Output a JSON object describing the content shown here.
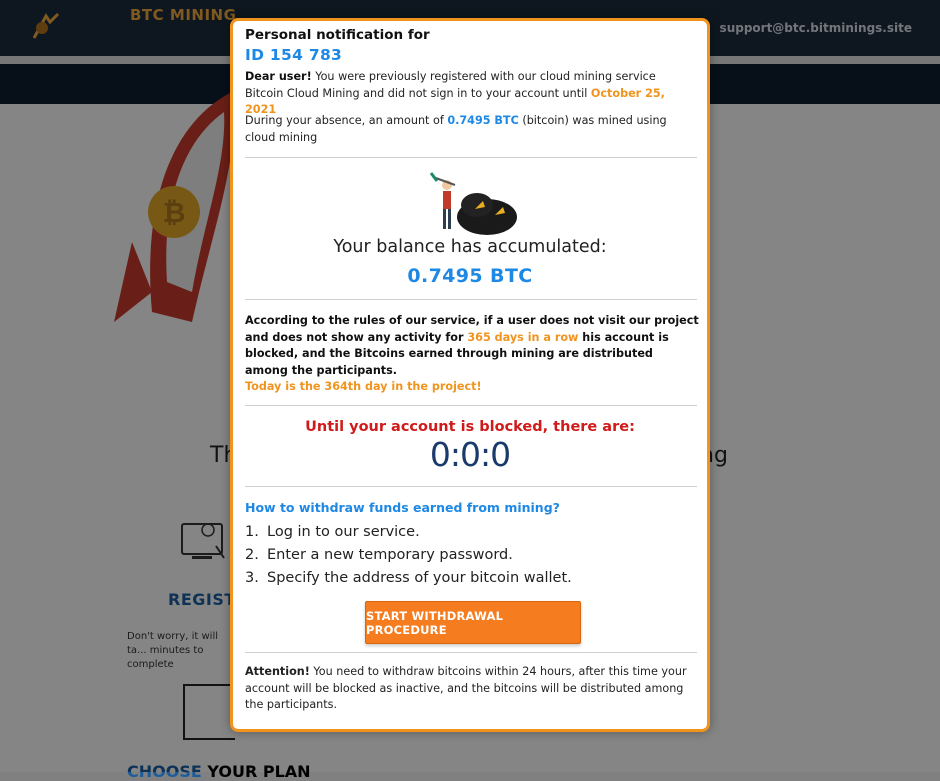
{
  "background": {
    "brand": "BTC MINING",
    "brand_sub": "",
    "support_email": "support@btc.bitminings.site",
    "section_title_left": "Th",
    "section_title_right": "ng",
    "register": "REGIST",
    "register_text": "Don't worry, it will ta... minutes to complete",
    "plan_accent": "CHOOSE",
    "plan_rest": " YOUR PLAN"
  },
  "modal": {
    "heading": "Personal notification for",
    "user_id": "ID 154 783",
    "greeting": "Dear user!",
    "intro": " You were previously registered with our cloud mining service Bitcoin Cloud Mining and did not sign in to your account until ",
    "last_date": "October 25, 2021",
    "absence_pre": "During your absence, an amount of ",
    "absence_amount": "0.7495 BTC",
    "absence_post": " (bitcoin) was mined using cloud mining",
    "balance_title": "Your balance has accumulated:",
    "balance_value": "0.7495 BTC",
    "rules_pre": "According to the rules of our service, if a user does not visit our project and does not show any activity for ",
    "rules_days": "365 days in a row",
    "rules_post": " his account is blocked, and the Bitcoins earned through mining are distributed among the participants.",
    "today_note": "Today is the 364th day in the project!",
    "until_blocked": "Until your account is blocked, there are:",
    "timer": "0:0:0",
    "howto_title": "How to withdraw funds earned from mining?",
    "steps": [
      {
        "num": "1.",
        "text": "Log in to our service."
      },
      {
        "num": "2.",
        "text": "Enter a new temporary password."
      },
      {
        "num": "3.",
        "text": "Specify the address of your bitcoin wallet."
      }
    ],
    "button_label": "START WITHDRAWAL PROCEDURE",
    "attention_label": "Attention!",
    "attention_text": " You need to withdraw bitcoins within 24 hours, after this time your account will be blocked as inactive, and the bitcoins will be distributed among the participants."
  },
  "colors": {
    "accent_orange": "#f0941e",
    "accent_blue": "#1e88e5",
    "alert_red": "#d11a1a",
    "button": "#f57c1f"
  },
  "icons": [
    "miner-icon",
    "rocket-image",
    "register-icon",
    "speed-icon",
    "logo-icon"
  ]
}
